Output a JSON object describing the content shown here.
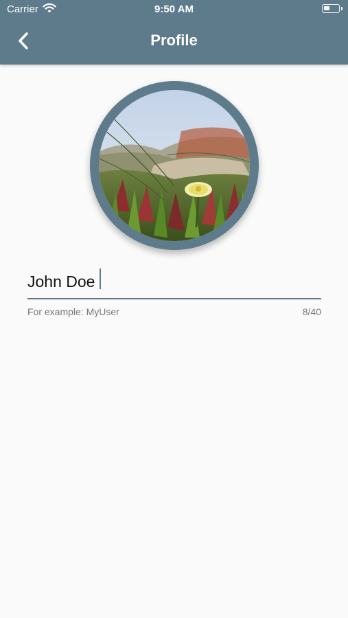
{
  "status_bar": {
    "carrier": "Carrier",
    "time": "9:50 AM"
  },
  "header": {
    "title": "Profile",
    "back_icon": "chevron-left-icon"
  },
  "profile": {
    "avatar_description_icon": "profile-photo",
    "name_value": "John Doe",
    "helper_text": "For example: MyUser",
    "counter": "8/40"
  },
  "colors": {
    "primary": "#5e7b8c",
    "background": "#fafafa"
  }
}
